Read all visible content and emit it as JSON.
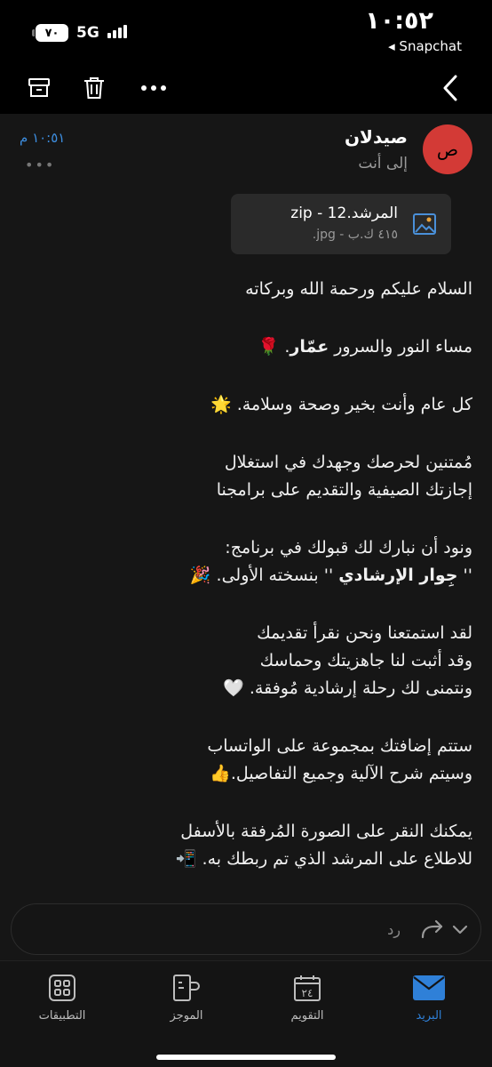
{
  "status_bar": {
    "time": "١٠:٥٢",
    "back_app": "Snapchat",
    "battery": "٧٠",
    "network": "5G"
  },
  "toolbar": {
    "icons": [
      "archive-icon",
      "trash-icon",
      "more-icon",
      "back-chevron-icon"
    ]
  },
  "message": {
    "avatar_letter": "ص",
    "sender": "صيدلان",
    "to": "إلى أنت",
    "time": "١٠:٥١ م",
    "more": "•••",
    "attachment": {
      "name": "المرشد.12 - zip",
      "meta": "٤١٥ ك.ب - jpg."
    },
    "body": {
      "p1": "السلام عليكم ورحمة الله وبركاته",
      "p2_a": "مساء النور والسرور ",
      "p2_name": "عمّار",
      "p2_b": ". 🌹",
      "p3": "كل عام وأنت بخير وصحة وسلامة. 🌟",
      "p4_l1": "مُمتنين لحرصك وجهدك في استغلال",
      "p4_l2": "إجازتك الصيفية والتقديم على برامجنا",
      "p5_l1": "ونود أن نبارك لك قبولك في برنامج:",
      "p5_q1": "'' ",
      "p5_prog": "جِوار الإرشادي",
      "p5_rest": " '' بنسخته الأولى. 🎉",
      "p6_l1": "لقد استمتعنا ونحن نقرأ تقديمك",
      "p6_l2": "وقد أثبت لنا جاهزيتك وحماسك",
      "p6_l3": "ونتمنى لك رحلة إرشادية مُوفقة. 🤍",
      "p7_l1": "ستتم إضافتك بمجموعة على الواتساب",
      "p7_l2": "وسيتم شرح الآلية وجميع التفاصيل.👍",
      "p8_l1": "يمكنك النقر على الصورة المُرفقة بالأسفل",
      "p8_l2": "للاطلاع على المرشد الذي تم ربطك به. 📲"
    }
  },
  "reply": {
    "placeholder": "رد"
  },
  "nav": {
    "mail": "البريد",
    "calendar": "التقويم",
    "calendar_day": "٢٤",
    "feed": "الموجز",
    "apps": "التطبيقات"
  },
  "colors": {
    "accent": "#2f80d8",
    "avatar": "#d33a36",
    "background": "#161616"
  }
}
